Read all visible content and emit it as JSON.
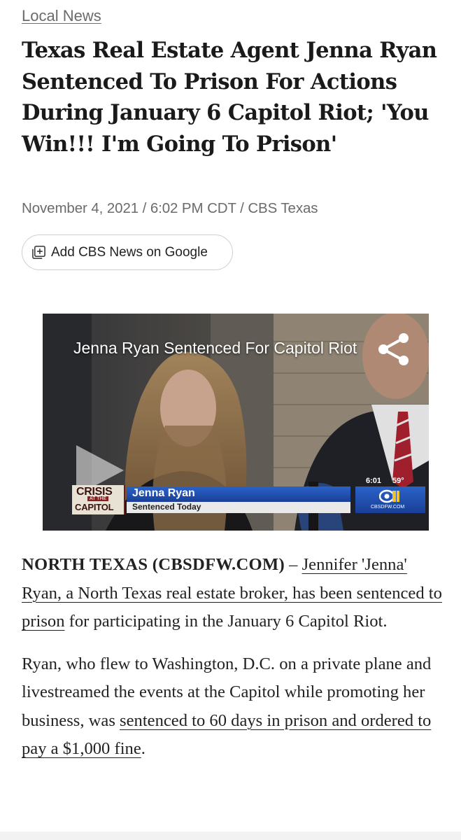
{
  "section": {
    "label": "Local News"
  },
  "headline": "Texas Real Estate Agent Jenna Ryan Sentenced To Prison For Actions During January 6 Capitol Riot; 'You Win!!! I'm Going To Prison'",
  "byline": "November 4, 2021 / 6:02 PM CDT / CBS Texas",
  "google_button": {
    "label": "Add CBS News on Google",
    "icon": "add-plus-icon"
  },
  "video": {
    "title": "Jenna Ryan Sentenced For Capitol Riot",
    "icons": [
      "share-icon",
      "play-icon"
    ],
    "lower_third": {
      "banner_top": "CRISIS",
      "banner_mid": "AT THE",
      "banner_bottom": "CAPITOL",
      "name": "Jenna Ryan",
      "subtitle": "Sentenced Today",
      "time": "6:01",
      "temp": "59°",
      "site": "CBSDFW.COM"
    }
  },
  "article": {
    "p1": {
      "dateline": "NORTH TEXAS (CBSDFW.COM)",
      "dash": " – ",
      "link": "Jennifer 'Jenna' Ryan, a North Texas real estate broker, has been sentenced to prison",
      "rest": " for participating in the January 6 Capitol Riot."
    },
    "p2": {
      "text": "Ryan, who flew to Washington, D.C. on a private plane and livestreamed the events at the Capitol while promoting her business, was ",
      "link": "sentenced to 60 days in prison and ordered to pay a $1,000 fine",
      "end": "."
    }
  }
}
